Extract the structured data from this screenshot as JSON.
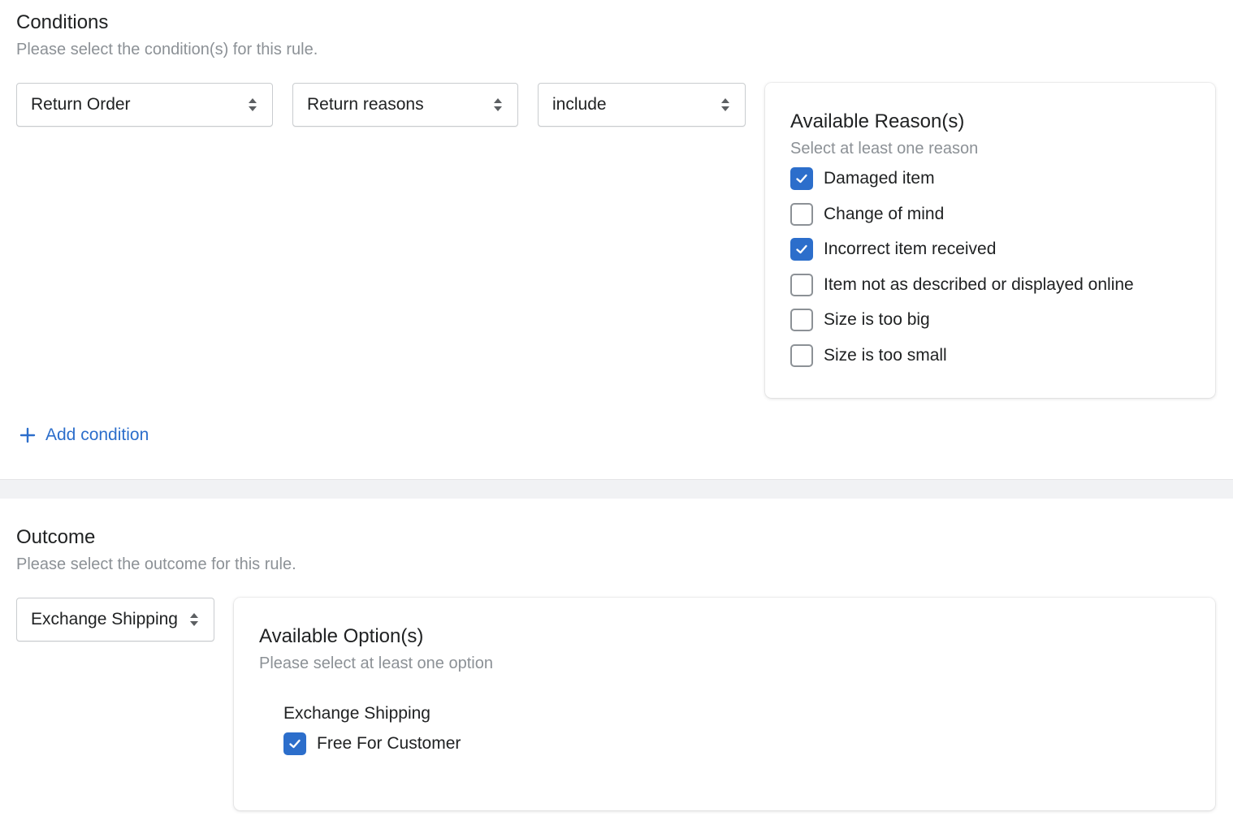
{
  "conditions": {
    "title": "Conditions",
    "subtitle": "Please select the condition(s) for this rule.",
    "selects": [
      {
        "value": "Return Order"
      },
      {
        "value": "Return reasons"
      },
      {
        "value": "include"
      }
    ],
    "reasons_card": {
      "title": "Available Reason(s)",
      "subtitle": "Select at least one reason",
      "items": [
        {
          "label": "Damaged item",
          "checked": true
        },
        {
          "label": "Change of mind",
          "checked": false
        },
        {
          "label": "Incorrect item received",
          "checked": true
        },
        {
          "label": "Item not as described or displayed online",
          "checked": false
        },
        {
          "label": "Size is too big",
          "checked": false
        },
        {
          "label": "Size is too small",
          "checked": false
        }
      ]
    },
    "add_condition_label": "Add condition"
  },
  "outcome": {
    "title": "Outcome",
    "subtitle": "Please select the outcome for this rule.",
    "select": {
      "value": "Exchange Shipping"
    },
    "options_card": {
      "title": "Available Option(s)",
      "subtitle": "Please select at least one option",
      "group_label": "Exchange Shipping",
      "items": [
        {
          "label": "Free For Customer",
          "checked": true
        }
      ]
    }
  },
  "colors": {
    "accent": "#2c6ecb",
    "muted_text": "#8c9196",
    "divider": "#f1f2f4"
  }
}
